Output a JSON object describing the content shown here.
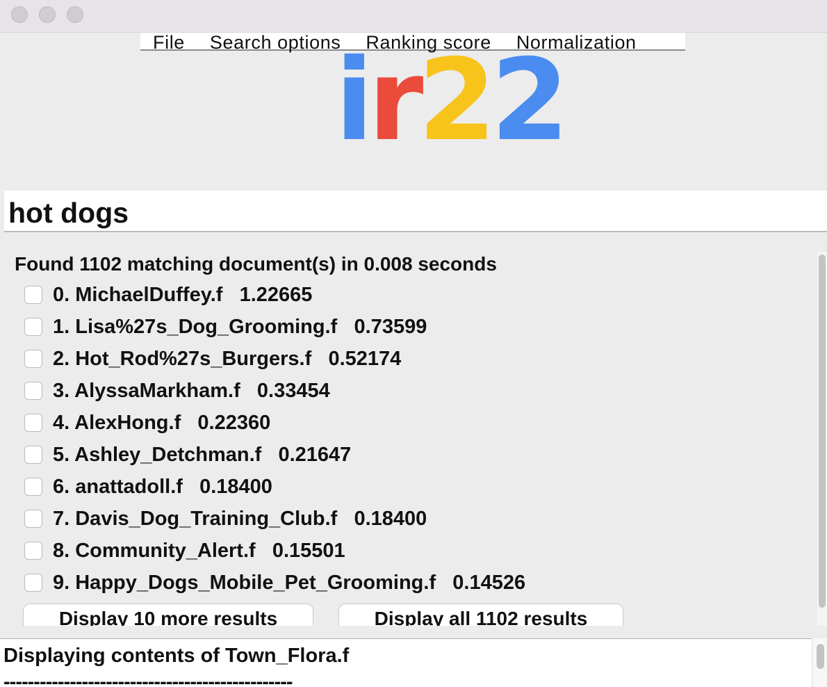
{
  "menu": {
    "items": [
      "File",
      "Search options",
      "Ranking score",
      "Normalization"
    ]
  },
  "logo": {
    "chars": [
      "i",
      "r",
      "2",
      "2"
    ],
    "colors": [
      "#4a8cf0",
      "#ea4b3a",
      "#f8c31b",
      "#4a8cf0"
    ]
  },
  "search": {
    "value": "hot dogs"
  },
  "results": {
    "header": "Found 1102 matching document(s) in 0.008 seconds",
    "items": [
      {
        "label": "0. MichaelDuffey.f   1.22665"
      },
      {
        "label": "1. Lisa%27s_Dog_Grooming.f   0.73599"
      },
      {
        "label": "2. Hot_Rod%27s_Burgers.f   0.52174"
      },
      {
        "label": "3. AlyssaMarkham.f   0.33454"
      },
      {
        "label": "4. AlexHong.f   0.22360"
      },
      {
        "label": "5. Ashley_Detchman.f   0.21647"
      },
      {
        "label": "6. anattadoll.f   0.18400"
      },
      {
        "label": "7. Davis_Dog_Training_Club.f   0.18400"
      },
      {
        "label": "8. Community_Alert.f   0.15501"
      },
      {
        "label": "9. Happy_Dogs_Mobile_Pet_Grooming.f   0.14526"
      }
    ],
    "more_button": "Display 10 more results",
    "all_button": "Display all 1102 results"
  },
  "contents": {
    "title": "Displaying contents of Town_Flora.f",
    "divider": "------------------------------------------------"
  }
}
